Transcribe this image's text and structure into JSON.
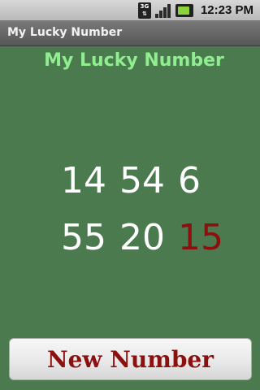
{
  "status_bar": {
    "network_label": "3G",
    "time": "12:23 PM"
  },
  "app": {
    "title": "My Lucky Number",
    "heading": "My Lucky Number"
  },
  "numbers": [
    "14",
    "54",
    "6",
    "55",
    "20",
    "15"
  ],
  "highlighted_number_index": 5,
  "colors": {
    "background": "#4a7a4e",
    "heading": "#90ee90",
    "number": "#ffffff",
    "highlight": "#8b1010"
  },
  "actions": {
    "new_number_label": "New Number"
  }
}
